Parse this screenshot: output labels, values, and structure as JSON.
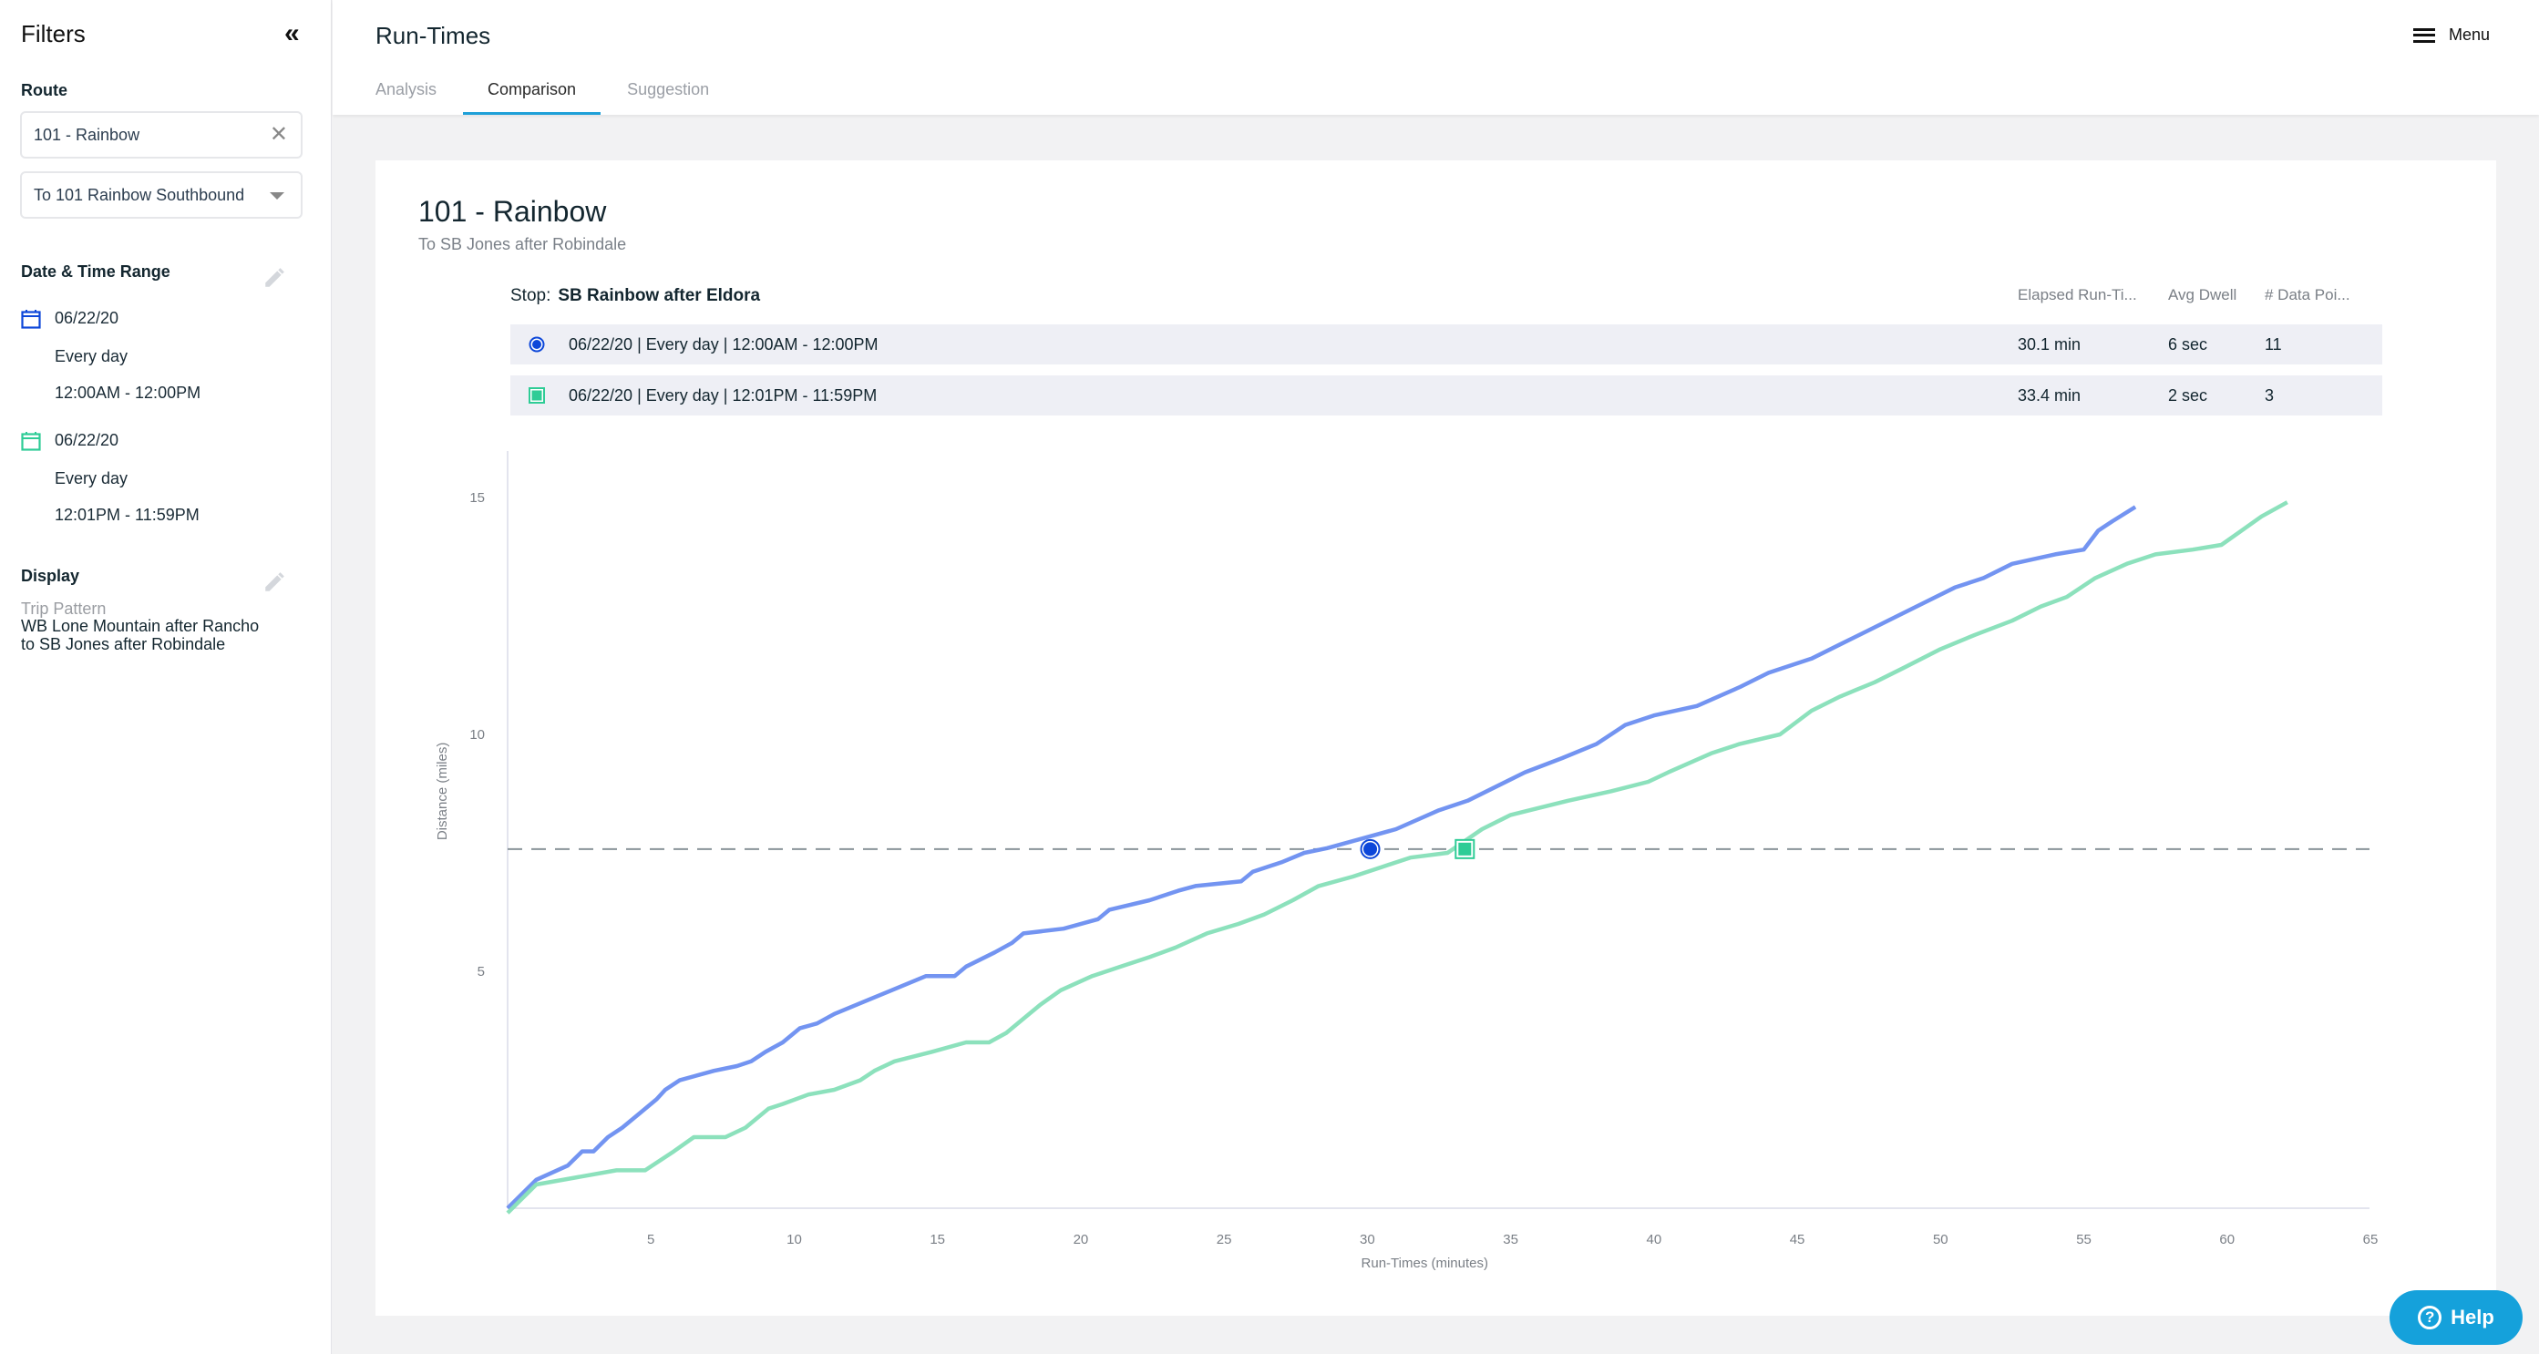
{
  "sidebar": {
    "title": "Filters",
    "collapse_icon": "double-chevron-left-icon",
    "route_label": "Route",
    "route_value": "101 - Rainbow",
    "direction_value": "To 101 Rainbow Southbound",
    "datetime_label": "Date & Time Range",
    "ranges": [
      {
        "date": "06/22/20",
        "days": "Every day",
        "time": "12:00AM - 12:00PM",
        "color": "#0d47d9"
      },
      {
        "date": "06/22/20",
        "days": "Every day",
        "time": "12:01PM - 11:59PM",
        "color": "#2ecc96"
      }
    ],
    "display_label": "Display",
    "trip_pattern_label": "Trip Pattern",
    "trip_pattern_line1": "WB Lone Mountain after Rancho",
    "trip_pattern_line2": "to SB Jones after Robindale"
  },
  "header": {
    "title": "Run-Times",
    "tabs": [
      {
        "label": "Analysis",
        "active": false
      },
      {
        "label": "Comparison",
        "active": true
      },
      {
        "label": "Suggestion",
        "active": false
      }
    ],
    "menu_label": "Menu"
  },
  "card": {
    "title": "101 - Rainbow",
    "subtitle": "To SB Jones after Robindale",
    "stop_prefix": "Stop:",
    "stop_name": "SB Rainbow after Eldora",
    "columns": [
      "Elapsed Run-Ti...",
      "Avg Dwell",
      "# Data Poi..."
    ],
    "rows": [
      {
        "label": "06/22/20 | Every day | 12:00AM - 12:00PM",
        "elapsed": "30.1 min",
        "dwell": "6 sec",
        "points": "11",
        "marker": "circle"
      },
      {
        "label": "06/22/20 | Every day | 12:01PM - 11:59PM",
        "elapsed": "33.4 min",
        "dwell": "2 sec",
        "points": "3",
        "marker": "square"
      }
    ]
  },
  "help_label": "Help",
  "chart_data": {
    "type": "line",
    "title": "",
    "xlabel": "Run-Times (minutes)",
    "ylabel": "Distance (miles)",
    "xlim": [
      0,
      65
    ],
    "ylim": [
      0,
      16
    ],
    "xticks": [
      5,
      10,
      15,
      20,
      25,
      30,
      35,
      40,
      45,
      50,
      55,
      60,
      65
    ],
    "yticks": [
      5,
      10,
      15
    ],
    "grid": false,
    "reference_line": {
      "y": 7.58,
      "style": "dashed",
      "color": "#8a9499"
    },
    "series": [
      {
        "name": "06/22/20 | Every day | 12:00AM - 12:00PM",
        "color": "#6b8ef0",
        "marker": {
          "x": 30.1,
          "y": 7.58,
          "shape": "circle",
          "color": "#0d47d9"
        },
        "points": [
          [
            0,
            0
          ],
          [
            1,
            0.6
          ],
          [
            2.1,
            0.9
          ],
          [
            2.6,
            1.2
          ],
          [
            3,
            1.2
          ],
          [
            3.5,
            1.5
          ],
          [
            4,
            1.7
          ],
          [
            4.6,
            2.0
          ],
          [
            5.2,
            2.3
          ],
          [
            5.5,
            2.5
          ],
          [
            6,
            2.7
          ],
          [
            7.2,
            2.9
          ],
          [
            8,
            3.0
          ],
          [
            8.5,
            3.1
          ],
          [
            9,
            3.3
          ],
          [
            9.6,
            3.5
          ],
          [
            10.2,
            3.8
          ],
          [
            10.8,
            3.9
          ],
          [
            11.4,
            4.1
          ],
          [
            12.6,
            4.4
          ],
          [
            13.4,
            4.6
          ],
          [
            14.6,
            4.9
          ],
          [
            15.6,
            4.9
          ],
          [
            16,
            5.1
          ],
          [
            17,
            5.4
          ],
          [
            17.6,
            5.6
          ],
          [
            18,
            5.8
          ],
          [
            19.4,
            5.9
          ],
          [
            20.6,
            6.1
          ],
          [
            21,
            6.3
          ],
          [
            22.4,
            6.5
          ],
          [
            23.4,
            6.7
          ],
          [
            24,
            6.8
          ],
          [
            25.6,
            6.9
          ],
          [
            26,
            7.1
          ],
          [
            27,
            7.3
          ],
          [
            27.8,
            7.5
          ],
          [
            28.6,
            7.6
          ],
          [
            29.8,
            7.8
          ],
          [
            30.1,
            7.58
          ],
          [
            31,
            8.0
          ],
          [
            32.5,
            8.4
          ],
          [
            33.5,
            8.6
          ],
          [
            34.5,
            8.9
          ],
          [
            35.5,
            9.2
          ],
          [
            36.8,
            9.5
          ],
          [
            38,
            9.8
          ],
          [
            39,
            10.2
          ],
          [
            40,
            10.4
          ],
          [
            41.5,
            10.6
          ],
          [
            43,
            11.0
          ],
          [
            44,
            11.3
          ],
          [
            45.5,
            11.6
          ],
          [
            46.5,
            11.9
          ],
          [
            47.5,
            12.2
          ],
          [
            48.5,
            12.5
          ],
          [
            49.5,
            12.8
          ],
          [
            50.5,
            13.1
          ],
          [
            51.5,
            13.3
          ],
          [
            52.5,
            13.6
          ],
          [
            54,
            13.8
          ],
          [
            55,
            13.9
          ],
          [
            55.5,
            14.3
          ],
          [
            56,
            14.5
          ],
          [
            56.8,
            14.8
          ]
        ]
      },
      {
        "name": "06/22/20 | Every day | 12:01PM - 11:59PM",
        "color": "#86dfb8",
        "marker": {
          "x": 33.4,
          "y": 7.58,
          "shape": "square",
          "color": "#2ecc96"
        },
        "points": [
          [
            0,
            -0.1
          ],
          [
            1,
            0.5
          ],
          [
            3.8,
            0.8
          ],
          [
            4.8,
            0.8
          ],
          [
            5.8,
            1.2
          ],
          [
            6.5,
            1.5
          ],
          [
            7.6,
            1.5
          ],
          [
            8.3,
            1.7
          ],
          [
            9.1,
            2.1
          ],
          [
            9.6,
            2.2
          ],
          [
            10.5,
            2.4
          ],
          [
            11.4,
            2.5
          ],
          [
            12.3,
            2.7
          ],
          [
            12.8,
            2.9
          ],
          [
            13.5,
            3.1
          ],
          [
            14.8,
            3.3
          ],
          [
            16,
            3.5
          ],
          [
            16.8,
            3.5
          ],
          [
            17.4,
            3.7
          ],
          [
            18,
            4.0
          ],
          [
            18.6,
            4.3
          ],
          [
            19.3,
            4.6
          ],
          [
            20.4,
            4.9
          ],
          [
            21.4,
            5.1
          ],
          [
            22.4,
            5.3
          ],
          [
            23.3,
            5.5
          ],
          [
            24.4,
            5.8
          ],
          [
            25.5,
            6.0
          ],
          [
            26.4,
            6.2
          ],
          [
            27.4,
            6.5
          ],
          [
            28.3,
            6.8
          ],
          [
            29.5,
            7.0
          ],
          [
            30.5,
            7.2
          ],
          [
            31.5,
            7.4
          ],
          [
            32.8,
            7.5
          ],
          [
            33.4,
            7.58
          ],
          [
            34,
            8.0
          ],
          [
            35,
            8.3
          ],
          [
            37,
            8.6
          ],
          [
            38.5,
            8.8
          ],
          [
            39.8,
            9.0
          ],
          [
            40.5,
            9.2
          ],
          [
            42,
            9.6
          ],
          [
            43,
            9.8
          ],
          [
            44.4,
            10.0
          ],
          [
            45.5,
            10.5
          ],
          [
            46.5,
            10.8
          ],
          [
            47.7,
            11.1
          ],
          [
            48.7,
            11.4
          ],
          [
            50,
            11.8
          ],
          [
            51.2,
            12.1
          ],
          [
            52.5,
            12.4
          ],
          [
            53.5,
            12.7
          ],
          [
            54.4,
            12.9
          ],
          [
            55.4,
            13.3
          ],
          [
            56.5,
            13.6
          ],
          [
            57.5,
            13.8
          ],
          [
            58.8,
            13.9
          ],
          [
            59.8,
            14.0
          ],
          [
            60.5,
            14.3
          ],
          [
            61.2,
            14.6
          ],
          [
            62.1,
            14.9
          ]
        ]
      }
    ]
  }
}
